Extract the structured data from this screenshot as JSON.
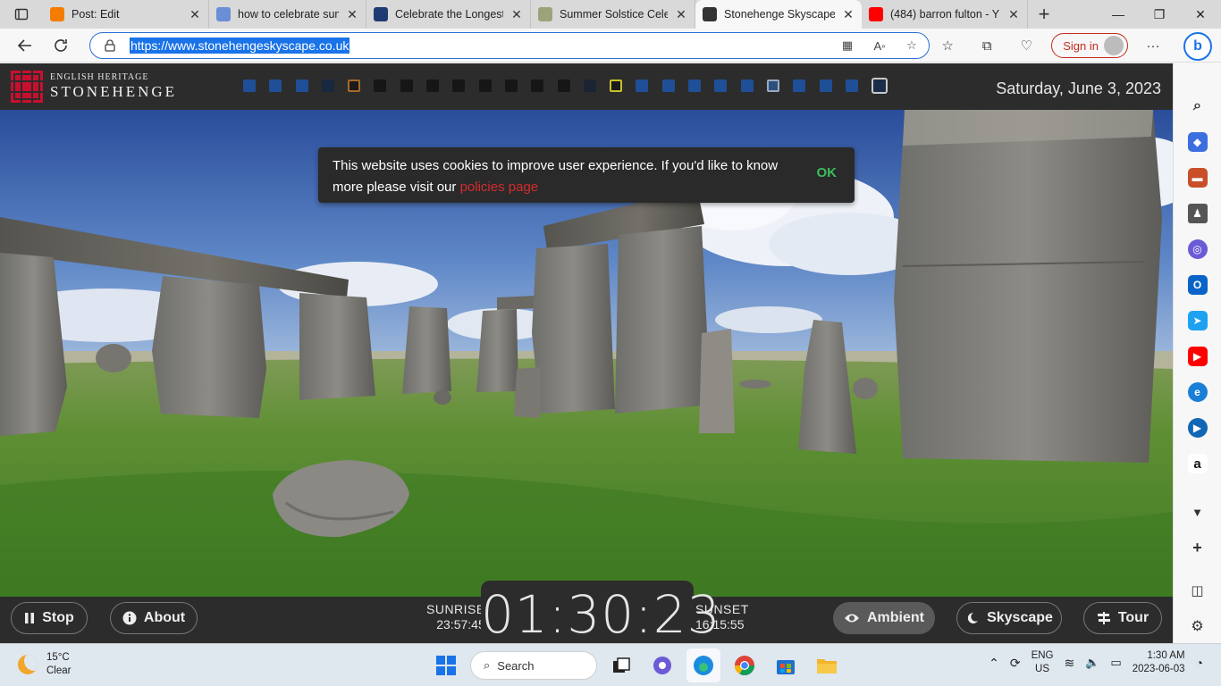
{
  "browser": {
    "tabs": [
      {
        "title": "Post: Edit",
        "favicon": "blogger-icon",
        "color": "#f57c00"
      },
      {
        "title": "how to celebrate summ",
        "favicon": "search-icon",
        "color": "#6b8fd6"
      },
      {
        "title": "Celebrate the Longest",
        "favicon": "circle-icon",
        "color": "#1f3b73"
      },
      {
        "title": "Summer Solstice Celeb",
        "favicon": "palm-icon",
        "color": "#9aa37a"
      },
      {
        "title": "Stonehenge Skyscape",
        "favicon": "stonehenge-icon",
        "color": "#333333",
        "active": true
      },
      {
        "title": "(484) barron fulton - Y",
        "favicon": "youtube-icon",
        "color": "#ff0000"
      }
    ],
    "url": "https://www.stonehengeskyscape.co.uk",
    "signin_label": "Sign in"
  },
  "site": {
    "logo_top": "ENGLISH HERITAGE",
    "logo_bottom": "STONEHENGE",
    "date": "Saturday, June 3, 2023",
    "dot_colors": [
      "#1f4f96",
      "#1f4f96",
      "#1f4f96",
      "#1a2740",
      "#a56a2a",
      "#161616",
      "#161616",
      "#161616",
      "#161616",
      "#161616",
      "#161616",
      "#161616",
      "#161616",
      "#1b2433",
      "#c8c12a",
      "#1f4f96",
      "#1f4f96",
      "#1f4f96",
      "#1f4f96",
      "#1f4f96",
      "#9aa9bf",
      "#1f4f96",
      "#1f4f96",
      "#1f4f96",
      "#1b2c4a"
    ],
    "cookie": {
      "message": "This website uses cookies to improve user experience. If you'd like to know more please visit our",
      "link": "policies page",
      "ok": "OK"
    },
    "controls": {
      "stop": "Stop",
      "about": "About",
      "ambient": "Ambient",
      "skyscape": "Skyscape",
      "tour": "Tour"
    },
    "sunrise_label": "SUNRISE",
    "sunrise_time": "23:57:45",
    "sunset_label": "SUNSET",
    "sunset_time": "16:15:55",
    "clock": "01:30:23"
  },
  "taskbar": {
    "temp": "15°C",
    "condition": "Clear",
    "search": "Search",
    "lang1": "ENG",
    "lang2": "US",
    "time": "1:30 AM",
    "date": "2023-06-03"
  }
}
